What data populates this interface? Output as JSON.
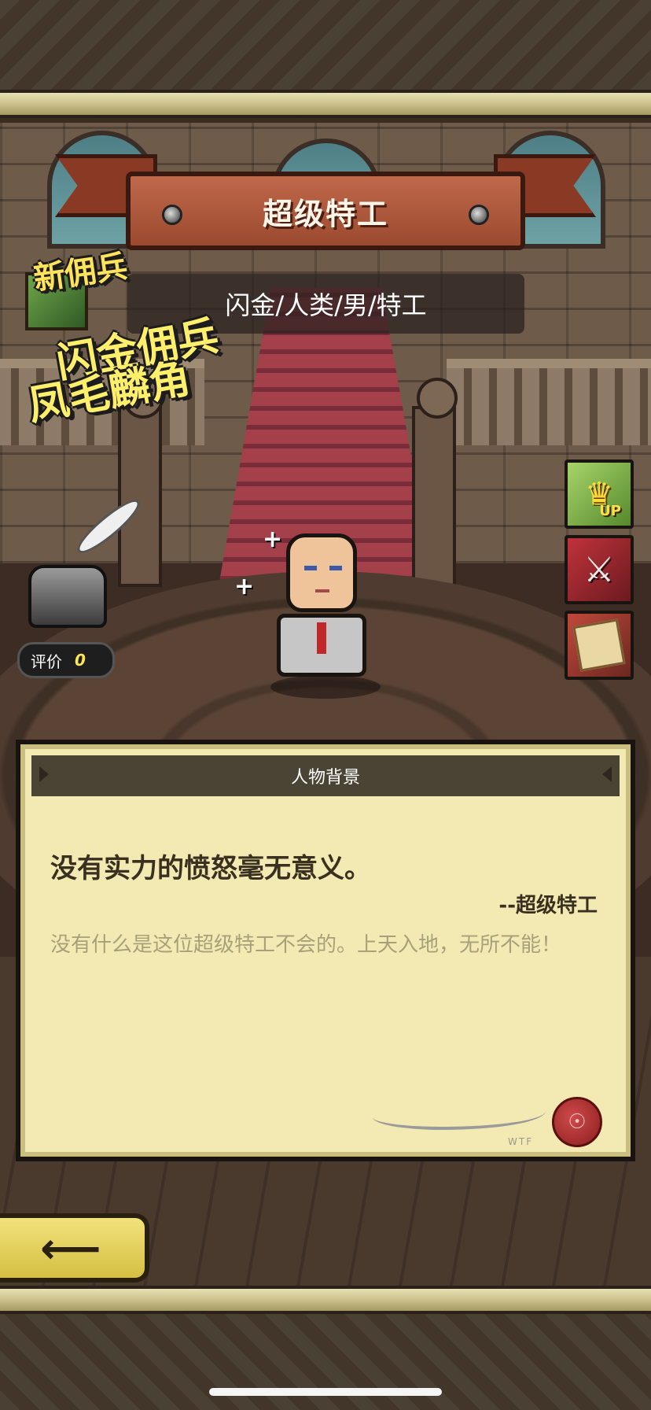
{
  "header": {
    "title": "超级特工",
    "subtitle": "闪金/人类/男/特工"
  },
  "badge": {
    "tag": "新佣兵",
    "line1": "闪金佣兵",
    "line2": "凤毛麟角"
  },
  "side_buttons": {
    "upgrade_label": "UP",
    "upgrade_icon": "crown-icon",
    "weapon_icon": "swords-icon",
    "map_icon": "scroll-map-icon"
  },
  "rating": {
    "label": "评价",
    "value": "0"
  },
  "story": {
    "section_title": "人物背景",
    "quote": "没有实力的愤怒毫无意义。",
    "quote_author": "--超级特工",
    "bio": "没有什么是这位超级特工不会的。上天入地，无所不能！",
    "signature_mark": "WTF"
  },
  "navigation": {
    "back_icon": "back-arrow-icon"
  },
  "colors": {
    "ribbon": "#9b4a30",
    "panel_bg": "#f3eab3",
    "panel_header": "#4a4434",
    "badge_text": "#ffef6a",
    "back_button": "#e8d560"
  }
}
